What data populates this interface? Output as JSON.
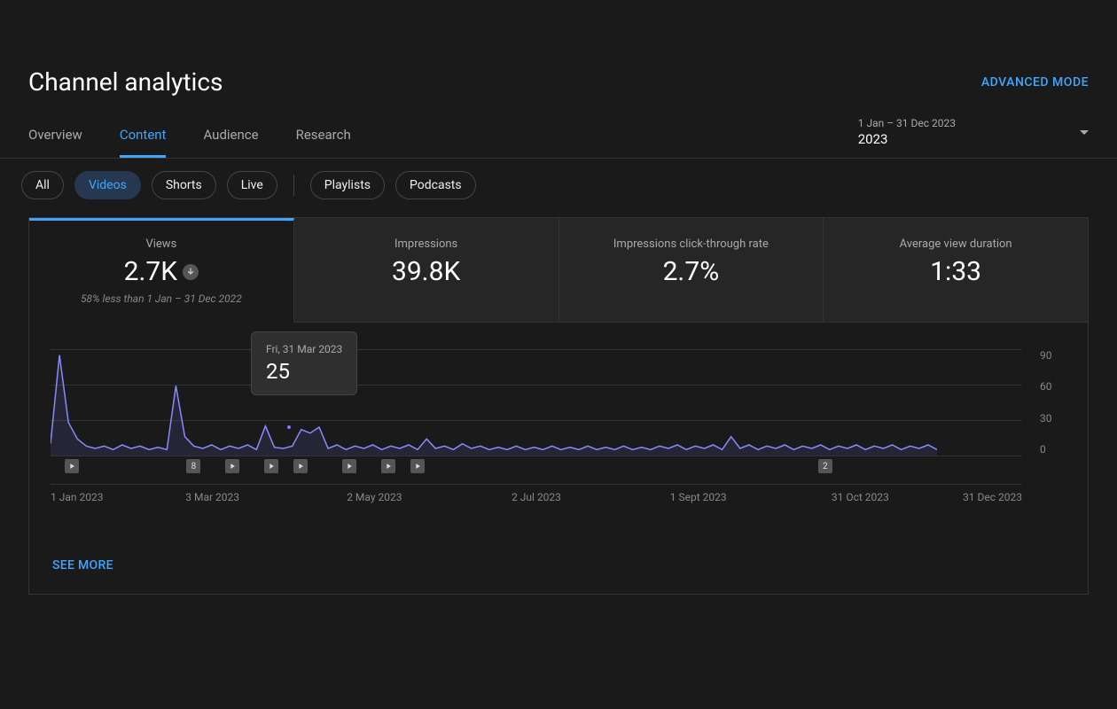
{
  "header": {
    "title": "Channel analytics",
    "advanced_mode": "ADVANCED MODE"
  },
  "tabs": [
    "Overview",
    "Content",
    "Audience",
    "Research"
  ],
  "active_tab": "Content",
  "date_picker": {
    "range": "1 Jan – 31 Dec 2023",
    "label": "2023"
  },
  "chips": {
    "group1": [
      "All",
      "Videos",
      "Shorts",
      "Live"
    ],
    "group2": [
      "Playlists",
      "Podcasts"
    ],
    "active": "Videos"
  },
  "metrics": [
    {
      "label": "Views",
      "value": "2.7K",
      "trend": "down",
      "compare": "58% less than 1 Jan – 31 Dec 2022",
      "active": true
    },
    {
      "label": "Impressions",
      "value": "39.8K",
      "active": false
    },
    {
      "label": "Impressions click-through rate",
      "value": "2.7%",
      "active": false
    },
    {
      "label": "Average view duration",
      "value": "1:33",
      "active": false
    }
  ],
  "chart_data": {
    "type": "line",
    "ylabel": "",
    "ylim": [
      0,
      90
    ],
    "y_ticks": [
      90,
      60,
      30,
      0
    ],
    "x_ticks": [
      "1 Jan 2023",
      "3 Mar 2023",
      "2 May 2023",
      "2 Jul 2023",
      "1 Sept 2023",
      "31 Oct 2023",
      "31 Dec 2023"
    ],
    "tooltip": {
      "date": "Fri, 31 Mar 2023",
      "value": "25"
    },
    "events": [
      {
        "pos": 1.5,
        "type": "play"
      },
      {
        "pos": 14,
        "type": "count",
        "label": "8"
      },
      {
        "pos": 18,
        "type": "play"
      },
      {
        "pos": 22,
        "type": "play"
      },
      {
        "pos": 25,
        "type": "play"
      },
      {
        "pos": 30,
        "type": "play"
      },
      {
        "pos": 34,
        "type": "play"
      },
      {
        "pos": 37,
        "type": "play"
      },
      {
        "pos": 79,
        "type": "count",
        "label": "2"
      }
    ],
    "series": [
      {
        "name": "Views",
        "values": [
          10,
          85,
          28,
          14,
          8,
          6,
          8,
          5,
          9,
          6,
          8,
          5,
          7,
          5,
          59,
          16,
          8,
          6,
          9,
          5,
          8,
          6,
          9,
          5,
          25,
          7,
          6,
          8,
          22,
          19,
          24,
          6,
          9,
          5,
          8,
          6,
          9,
          5,
          8,
          6,
          9,
          5,
          14,
          6,
          8,
          5,
          10,
          6,
          8,
          5,
          7,
          5,
          8,
          5,
          7,
          5,
          8,
          5,
          7,
          5,
          8,
          5,
          7,
          5,
          8,
          5,
          7,
          5,
          8,
          6,
          9,
          5,
          8,
          6,
          9,
          5,
          16,
          6,
          9,
          5,
          8,
          6,
          9,
          5,
          8,
          6,
          9,
          5,
          8,
          6,
          9,
          5,
          8,
          6,
          9,
          5,
          8,
          6,
          9,
          5
        ]
      }
    ]
  },
  "see_more": "SEE MORE"
}
